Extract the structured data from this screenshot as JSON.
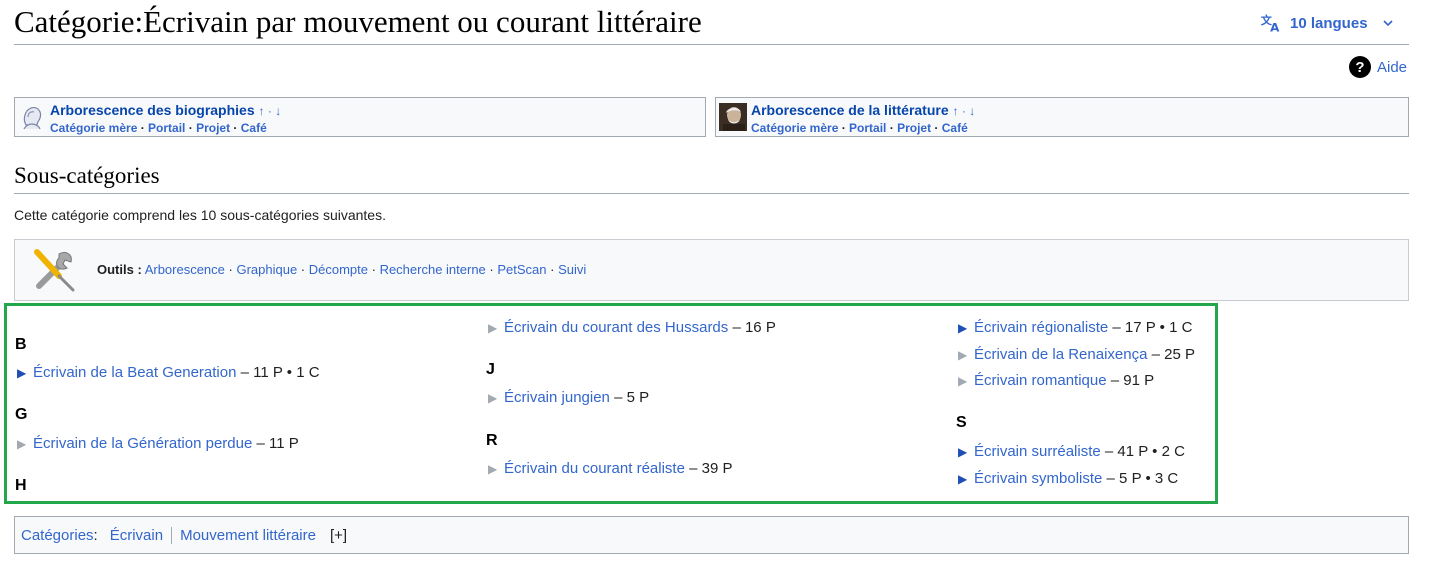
{
  "header": {
    "title": "Catégorie:Écrivain par mouvement ou courant littéraire",
    "languages_label": "10 langues",
    "help_label": "Aide"
  },
  "portals": [
    {
      "title": "Arborescence des biographies",
      "arrows": "↑ · ↓",
      "links": [
        "Catégorie mère",
        "Portail",
        "Projet",
        "Café"
      ]
    },
    {
      "title": "Arborescence de la littérature",
      "arrows": "↑ · ↓",
      "links": [
        "Catégorie mère",
        "Portail",
        "Projet",
        "Café"
      ]
    }
  ],
  "subcategories": {
    "heading": "Sous-catégories",
    "description": "Cette catégorie comprend les 10 sous-catégories suivantes."
  },
  "tools": {
    "label": "Outils :",
    "links": [
      "Arborescence",
      "Graphique",
      "Décompte",
      "Recherche interne",
      "PetScan",
      "Suivi"
    ]
  },
  "listing": {
    "letters": [
      "B",
      "G",
      "H",
      "J",
      "R",
      "S"
    ],
    "entries": [
      {
        "name": "Écrivain de la Beat Generation",
        "count": "– 11 P • 1 C",
        "expandable": true
      },
      {
        "name": "Écrivain de la Génération perdue",
        "count": "– 11 P",
        "expandable": false
      },
      {
        "name": "Écrivain du courant des Hussards",
        "count": "– 16 P",
        "expandable": false
      },
      {
        "name": "Écrivain jungien",
        "count": "– 5 P",
        "expandable": false
      },
      {
        "name": "Écrivain du courant réaliste",
        "count": "– 39 P",
        "expandable": false
      },
      {
        "name": "Écrivain régionaliste",
        "count": "– 17 P • 1 C",
        "expandable": true
      },
      {
        "name": "Écrivain de la Renaixença",
        "count": "– 25 P",
        "expandable": false
      },
      {
        "name": "Écrivain romantique",
        "count": "– 91 P",
        "expandable": false
      },
      {
        "name": "Écrivain surréaliste",
        "count": "– 41 P • 2 C",
        "expandable": true
      },
      {
        "name": "Écrivain symboliste",
        "count": "– 5 P • 3 C",
        "expandable": true
      }
    ],
    "triangle": "▶"
  },
  "catlinks": {
    "label": "Catégories",
    "colon": " :",
    "items": [
      "Écrivain",
      "Mouvement littéraire"
    ],
    "toggle": "[+]"
  },
  "colors": {
    "link": "#3366cc",
    "accent_border": "#22a84a"
  }
}
